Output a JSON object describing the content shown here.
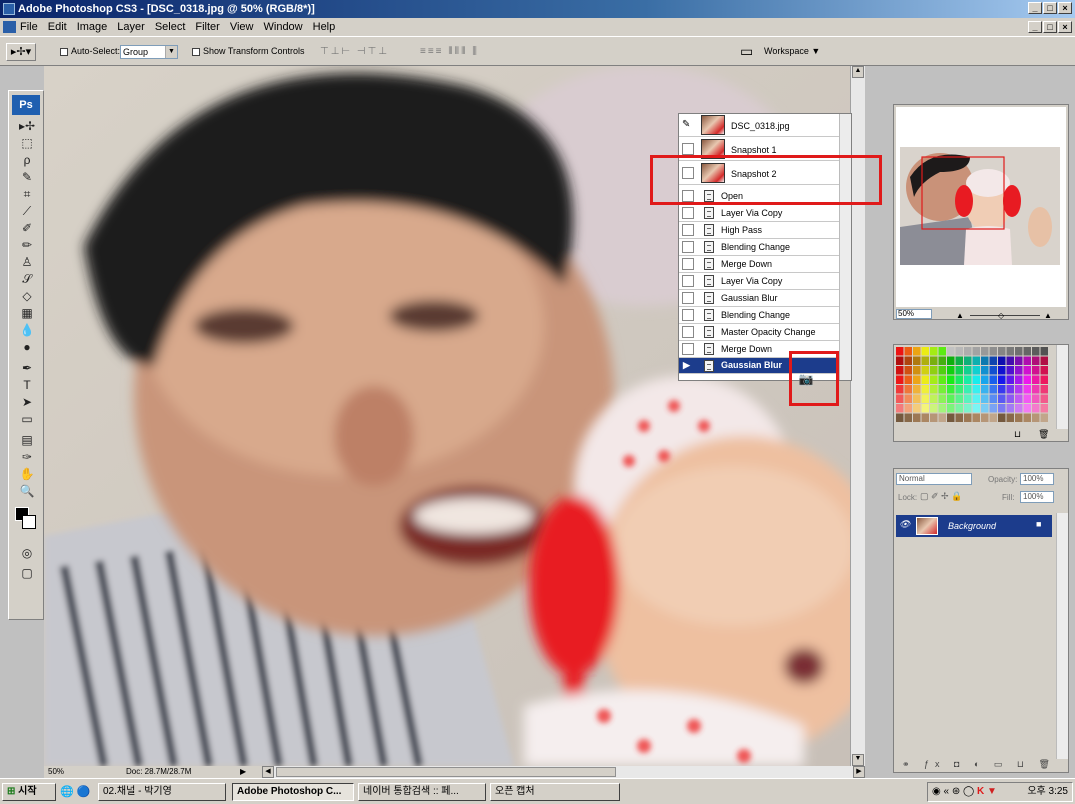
{
  "window": {
    "title": "Adobe Photoshop CS3 - [DSC_0318.jpg @ 50% (RGB/8*)]"
  },
  "menu": [
    "File",
    "Edit",
    "Image",
    "Layer",
    "Select",
    "Filter",
    "View",
    "Window",
    "Help"
  ],
  "options_bar": {
    "auto_select_label": "Auto-Select:",
    "auto_select_value": "Group",
    "show_transform_label": "Show Transform Controls",
    "workspace_label": "Workspace ▼"
  },
  "toolbox": {
    "logo": "Ps",
    "tools": [
      "move-tool-icon",
      "marquee-tool-icon",
      "lasso-tool-icon",
      "magic-wand-tool-icon",
      "crop-tool-icon",
      "slice-tool-icon",
      "healing-brush-tool-icon",
      "brush-tool-icon",
      "clone-stamp-tool-icon",
      "history-brush-tool-icon",
      "eraser-tool-icon",
      "gradient-tool-icon",
      "blur-tool-icon",
      "dodge-tool-icon",
      "pen-tool-icon",
      "type-tool-icon",
      "path-selection-tool-icon",
      "shape-tool-icon",
      "notes-tool-icon",
      "eyedropper-tool-icon",
      "hand-tool-icon",
      "zoom-tool-icon"
    ]
  },
  "history": {
    "snapshots": [
      "DSC_0318.jpg",
      "Snapshot 1",
      "Snapshot 2"
    ],
    "states": [
      "Open",
      "Layer Via Copy",
      "High Pass",
      "Blending Change",
      "Merge Down",
      "Layer Via Copy",
      "Gaussian Blur",
      "Blending Change",
      "Master Opacity Change",
      "Merge Down",
      "Gaussian Blur"
    ],
    "active_state": "Gaussian Blur"
  },
  "navigator": {
    "zoom": "50%"
  },
  "layers": {
    "blend_mode": "Normal",
    "opacity_label": "Opacity:",
    "opacity": "100%",
    "lock_label": "Lock:",
    "fill_label": "Fill:",
    "fill": "100%",
    "layer_name": "Background"
  },
  "status": {
    "zoom": "50%",
    "doc": "Doc: 28.7M/28.7M"
  },
  "taskbar": {
    "start": "시작",
    "tasks": [
      "02.채널 - 박기영",
      "Adobe Photoshop C...",
      "네이버 통합검색 :: 페...",
      "오픈 캡처"
    ],
    "clock": "오후 3:25"
  },
  "colors": {
    "title_bar": "#0a246a",
    "highlight_box": "#e01a1a",
    "active_history": "#1c3c8c",
    "ps_blue": "#1f5fb0"
  }
}
